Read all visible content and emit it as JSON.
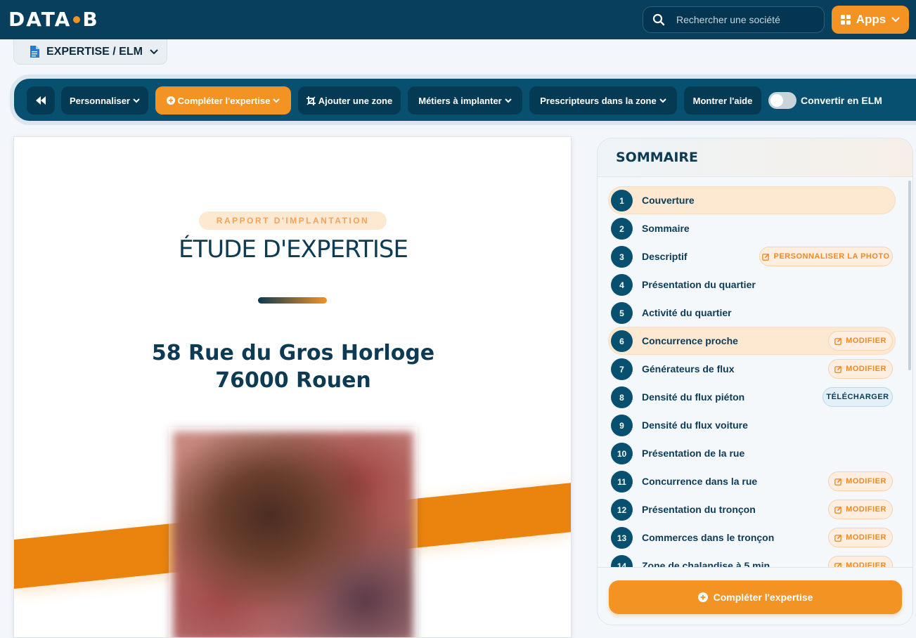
{
  "app": {
    "logo_text_left": "DATA",
    "logo_text_right": "B",
    "search_placeholder": "Rechercher une société",
    "apps_label": "Apps"
  },
  "doc_tab": {
    "label": "EXPERTISE / ELM"
  },
  "toolbar": {
    "customize": "Personnaliser",
    "complete": "Compléter l'expertise",
    "add_zone": "Ajouter une zone",
    "trades": "Métiers à implanter",
    "prescribers": "Prescripteurs dans la zone",
    "help": "Montrer l'aide",
    "convert_label": "Convertir en ELM",
    "convert_on": false
  },
  "cover": {
    "badge": "RAPPORT D'IMPLANTATION",
    "title": "ÉTUDE D'EXPERTISE",
    "address_line1": "58 Rue du Gros Horloge",
    "address_line2": "76000 Rouen"
  },
  "sommaire": {
    "title": "SOMMAIRE",
    "items": [
      {
        "n": "1",
        "label": "Couverture",
        "active": true
      },
      {
        "n": "2",
        "label": "Sommaire"
      },
      {
        "n": "3",
        "label": "Descriptif",
        "action": "PERSONNALISER LA PHOTO",
        "action_style": "orange"
      },
      {
        "n": "4",
        "label": "Présentation du quartier"
      },
      {
        "n": "5",
        "label": "Activité du quartier"
      },
      {
        "n": "6",
        "label": "Concurrence proche",
        "action": "MODIFIER",
        "action_style": "orange",
        "active": true
      },
      {
        "n": "7",
        "label": "Générateurs de flux",
        "action": "MODIFIER",
        "action_style": "orange"
      },
      {
        "n": "8",
        "label": "Densité du flux piéton",
        "action": "TÉLÉCHARGER",
        "action_style": "blue"
      },
      {
        "n": "9",
        "label": "Densité du flux voiture"
      },
      {
        "n": "10",
        "label": "Présentation de la rue"
      },
      {
        "n": "11",
        "label": "Concurrence dans la rue",
        "action": "MODIFIER",
        "action_style": "orange"
      },
      {
        "n": "12",
        "label": "Présentation du tronçon",
        "action": "MODIFIER",
        "action_style": "orange"
      },
      {
        "n": "13",
        "label": "Commerces dans le tronçon",
        "action": "MODIFIER",
        "action_style": "orange"
      },
      {
        "n": "14",
        "label": "Zone de chalandise à 5 min",
        "action": "MODIFIER",
        "action_style": "orange"
      }
    ],
    "cta": "Compléter l'expertise"
  },
  "colors": {
    "navy": "#073f5c",
    "accent": "#f39323"
  }
}
